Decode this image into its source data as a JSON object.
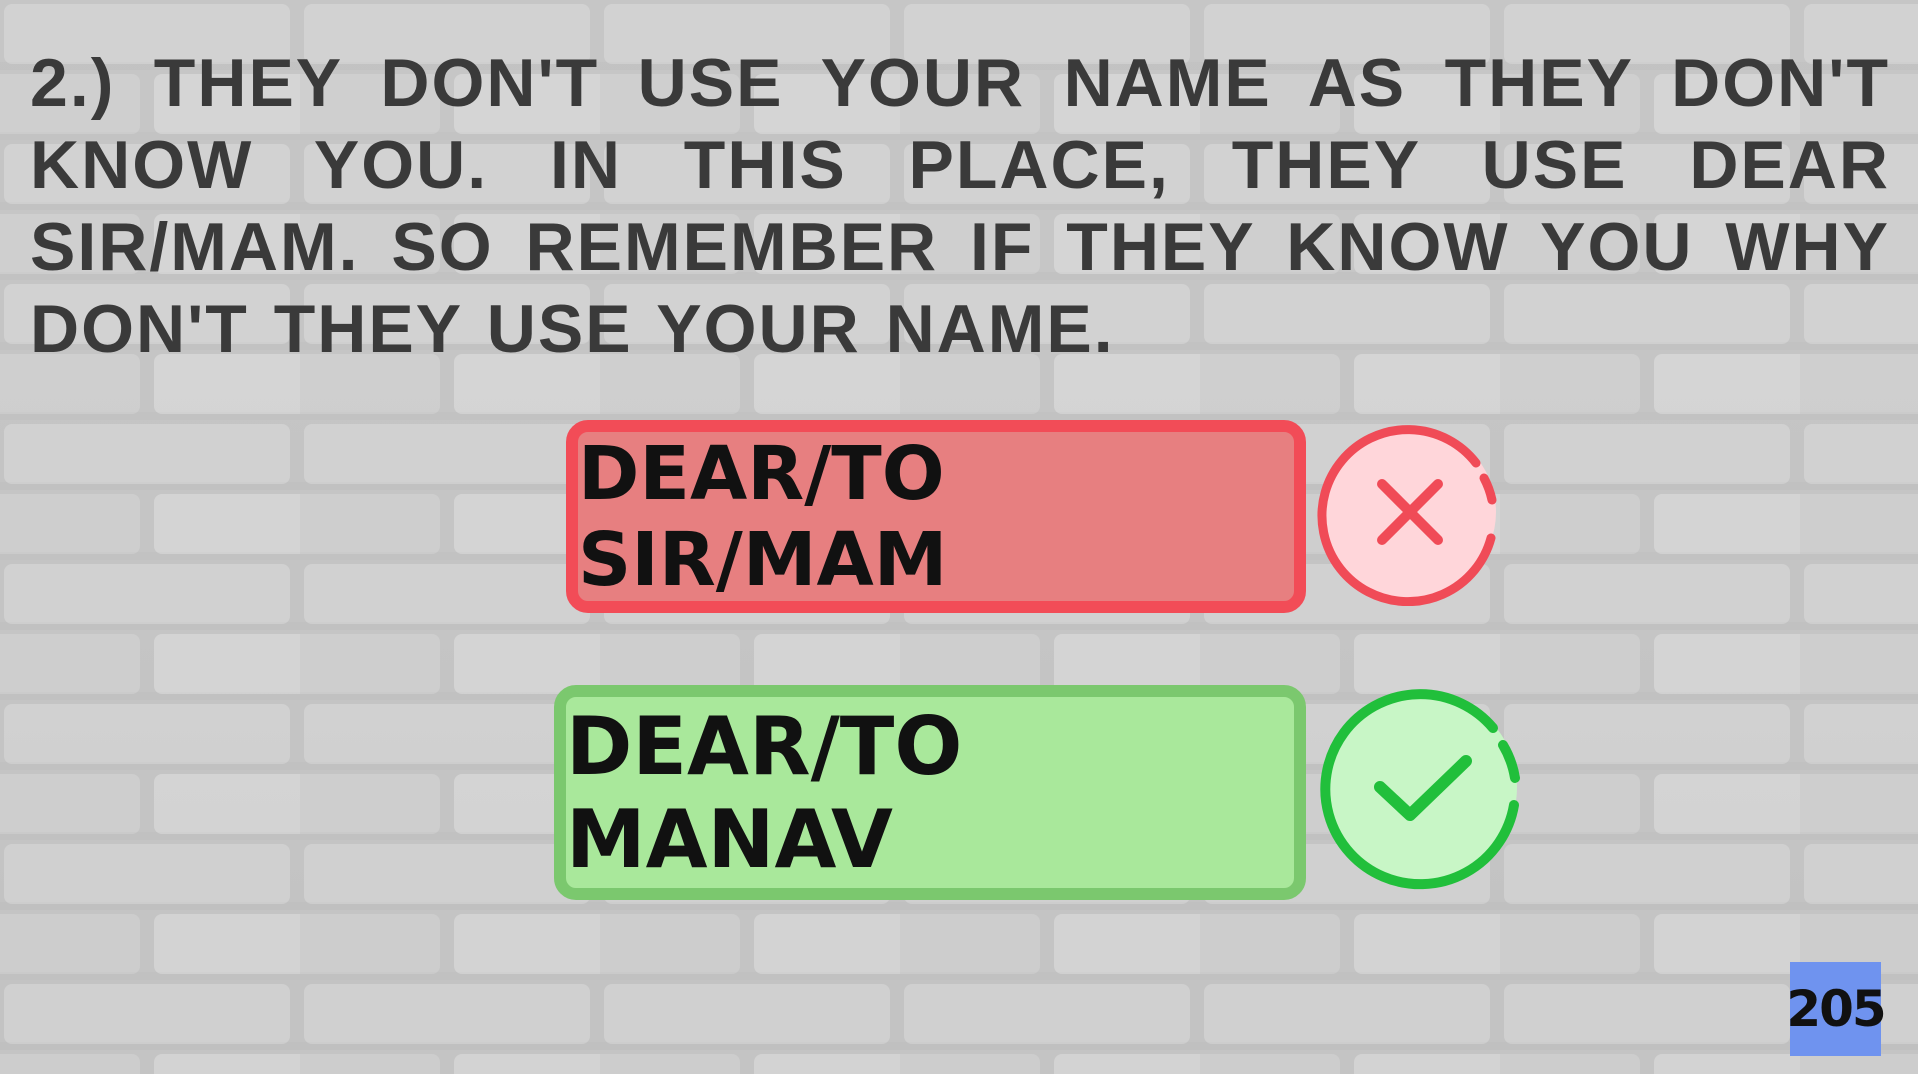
{
  "paragraph": {
    "text": "2.) THEY DON'T USE YOUR NAME AS THEY DON'T KNOW YOU. IN THIS PLACE, THEY USE DEAR SIR/MAM. SO REMEMBER IF THEY KNOW YOU WHY DON'T THEY USE YOUR NAME."
  },
  "examples": {
    "wrong": {
      "label": "DEAR/TO SIR/MAM",
      "icon": "x-icon",
      "color": "#f24c57",
      "fill": "#e77f80"
    },
    "right": {
      "label": "DEAR/TO MANAV",
      "icon": "check-icon",
      "color": "#1fbf3a",
      "fill": "#a9e89b"
    }
  },
  "page_number": "205",
  "colors": {
    "text": "#3a3a3a",
    "page_badge": "#6f93ef"
  }
}
